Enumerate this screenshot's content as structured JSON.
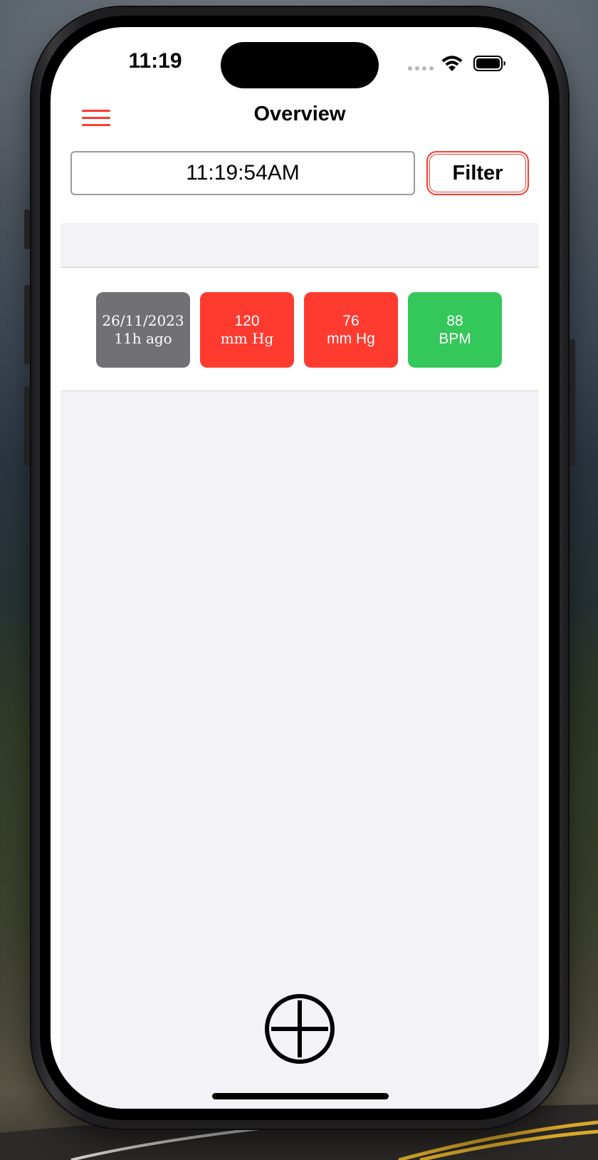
{
  "status_bar": {
    "time": "11:19",
    "icons": [
      "cellular-icon",
      "wifi-icon",
      "battery-icon"
    ]
  },
  "nav": {
    "menu_icon": "hamburger-menu-icon",
    "title": "Overview"
  },
  "filter_bar": {
    "time_value": "11:19:54AM",
    "filter_label": "Filter"
  },
  "readings": [
    {
      "date": "26/11/2023",
      "ago": "11h ago",
      "systolic_value": "120",
      "systolic_unit": "mm Hg",
      "diastolic_value": "76",
      "diastolic_unit": "mm Hg",
      "pulse_value": "88",
      "pulse_unit": "BPM"
    }
  ],
  "add_icon": "plus-circle-icon",
  "colors": {
    "accent": "#ff3b30",
    "high": "#ff3b30",
    "normal": "#34c759",
    "date_tile": "#707075",
    "list_background": "#f2f2f7"
  }
}
